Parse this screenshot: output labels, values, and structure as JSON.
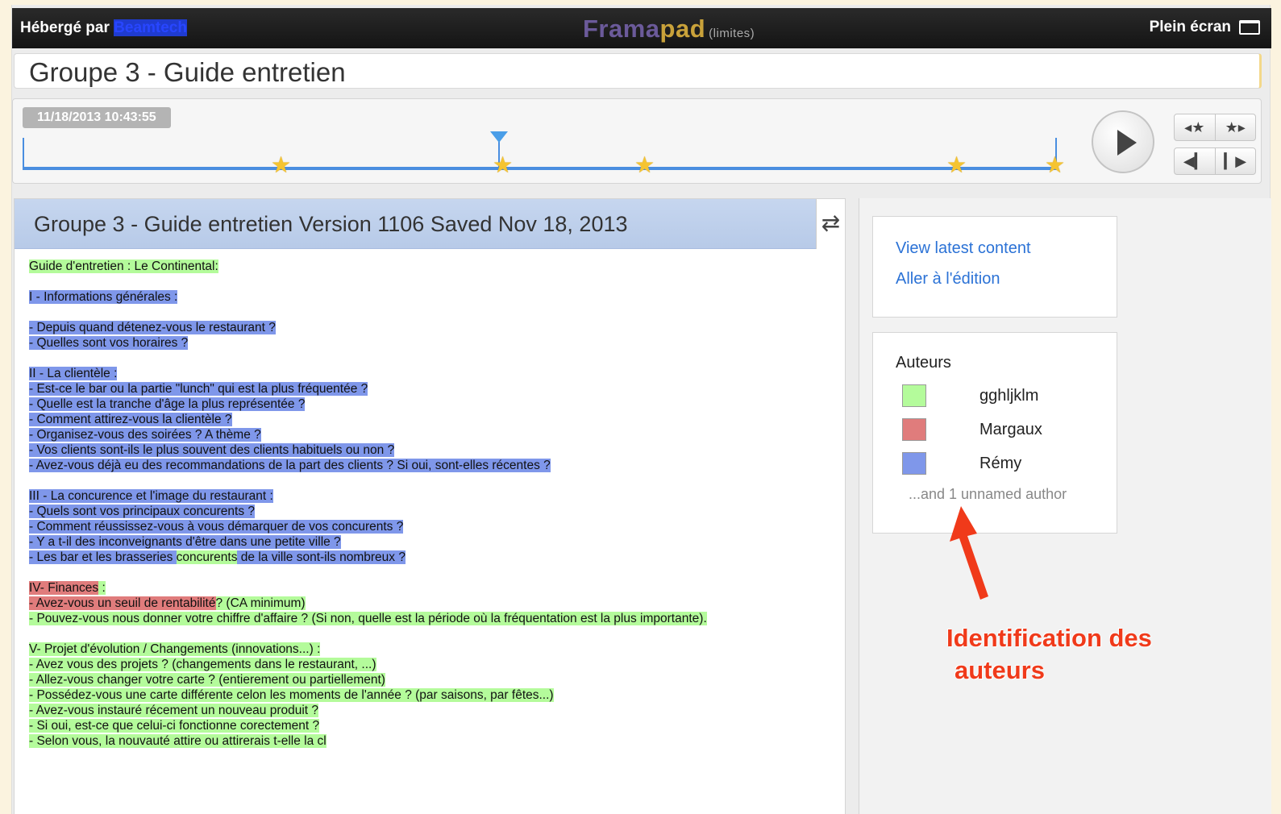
{
  "topbar": {
    "host_prefix": "Hébergé par",
    "host_link": "Beamtech",
    "brand_part1": "Frama",
    "brand_part2": "pad",
    "brand_suffix": "(limites)",
    "fullscreen_label": "Plein écran"
  },
  "pad_title": "Groupe 3 - Guide entretien",
  "timeslider": {
    "timestamp": "11/18/2013 10:43:55",
    "star_icon": "star-icon",
    "buttons": {
      "prev_star": "◂★",
      "next_star": "★▸",
      "step_back": "◀▎",
      "step_forward": "▎▶"
    }
  },
  "editor": {
    "header": "Groupe 3 - Guide entretien Version 1106 Saved Nov 18, 2013",
    "swap_icon": "⇄",
    "lines": [
      [
        {
          "t": "Guide d'entretien : Le Continental:",
          "c": "g"
        }
      ],
      [],
      [
        {
          "t": "I - Informations générales :",
          "c": "b"
        }
      ],
      [],
      [
        {
          "t": "- Depuis quand détenez-vous le restaurant ?",
          "c": "b"
        }
      ],
      [
        {
          "t": "- Quelles sont vos horaires ?",
          "c": "b"
        }
      ],
      [],
      [
        {
          "t": "II - La clientèle :",
          "c": "b"
        }
      ],
      [
        {
          "t": "- Est-ce le bar ou la partie \"lunch\" qui est la plus fréquentée ?",
          "c": "b"
        }
      ],
      [
        {
          "t": "- Quelle est la tranche d'âge la plus représentée ?",
          "c": "b"
        }
      ],
      [
        {
          "t": "- Comment attirez-vous la clientèle ?",
          "c": "b"
        }
      ],
      [
        {
          "t": "- Organisez-vous des soirées ? A thème ?",
          "c": "b"
        }
      ],
      [
        {
          "t": "- Vos clients sont-ils le plus souvent des clients habituels ou non ?",
          "c": "b"
        }
      ],
      [
        {
          "t": "- Avez-vous déjà eu des recommandations de la part des clients ? Si oui, sont-elles récentes ?",
          "c": "b"
        }
      ],
      [],
      [
        {
          "t": "III - La concurence et l'image du restaurant :",
          "c": "b"
        }
      ],
      [
        {
          "t": "- Quels sont vos principaux concurents ?",
          "c": "b"
        }
      ],
      [
        {
          "t": "- Comment réussissez-vous à vous démarquer de vos concurents ?",
          "c": "b"
        }
      ],
      [
        {
          "t": "- Y a t-il des inconveignants d'être dans une petite ville ?",
          "c": "b"
        }
      ],
      [
        {
          "t": "- Les bar et les brasseries ",
          "c": "b"
        },
        {
          "t": "concurents",
          "c": "g"
        },
        {
          "t": " de la ville sont-ils nombreux ?",
          "c": "b"
        }
      ],
      [],
      [
        {
          "t": "IV- Finances",
          "c": "r"
        },
        {
          "t": " :",
          "c": "g"
        }
      ],
      [
        {
          "t": "- Avez-vous un seuil de rentabilité",
          "c": "r"
        },
        {
          "t": "? (CA minimum)",
          "c": "g"
        }
      ],
      [
        {
          "t": "- Pouvez-vous nous donner votre chiffre d'affaire ? (Si non, quelle est la période où la fréquentation est la plus importante).",
          "c": "g"
        }
      ],
      [],
      [
        {
          "t": "V- Projet d'évolution / Changements (innovations...) :",
          "c": "g"
        }
      ],
      [
        {
          "t": "- Avez vous des projets ? (changements dans le restaurant, ...)",
          "c": "g"
        }
      ],
      [
        {
          "t": "- Allez-vous changer votre carte ? (entierement ou partiellement)",
          "c": "g"
        }
      ],
      [
        {
          "t": "- Possédez-vous une carte différente celon les moments de l'année ? (par saisons, par fêtes...)",
          "c": "g"
        }
      ],
      [
        {
          "t": "- Avez-vous instauré récement un nouveau produit ?",
          "c": "g"
        }
      ],
      [
        {
          "t": "- Si oui, est-ce que celui-ci fonctionne corectement ?",
          "c": "g"
        }
      ],
      [
        {
          "t": "- Selon vous, la nouvauté attire ou attirerais t-elle la cl",
          "c": "g"
        }
      ]
    ]
  },
  "sidebar": {
    "view_latest": "View latest content",
    "go_edit": "Aller à l'édition",
    "authors_title": "Auteurs",
    "authors": [
      {
        "name": "gghljklm",
        "color": "#b4fb9b"
      },
      {
        "name": "Margaux",
        "color": "#e07c7c"
      },
      {
        "name": "Rémy",
        "color": "#7f97ea"
      }
    ],
    "unnamed": "...and 1 unnamed author"
  },
  "annotation": {
    "line1": "Identification des",
    "line2": "auteurs"
  }
}
